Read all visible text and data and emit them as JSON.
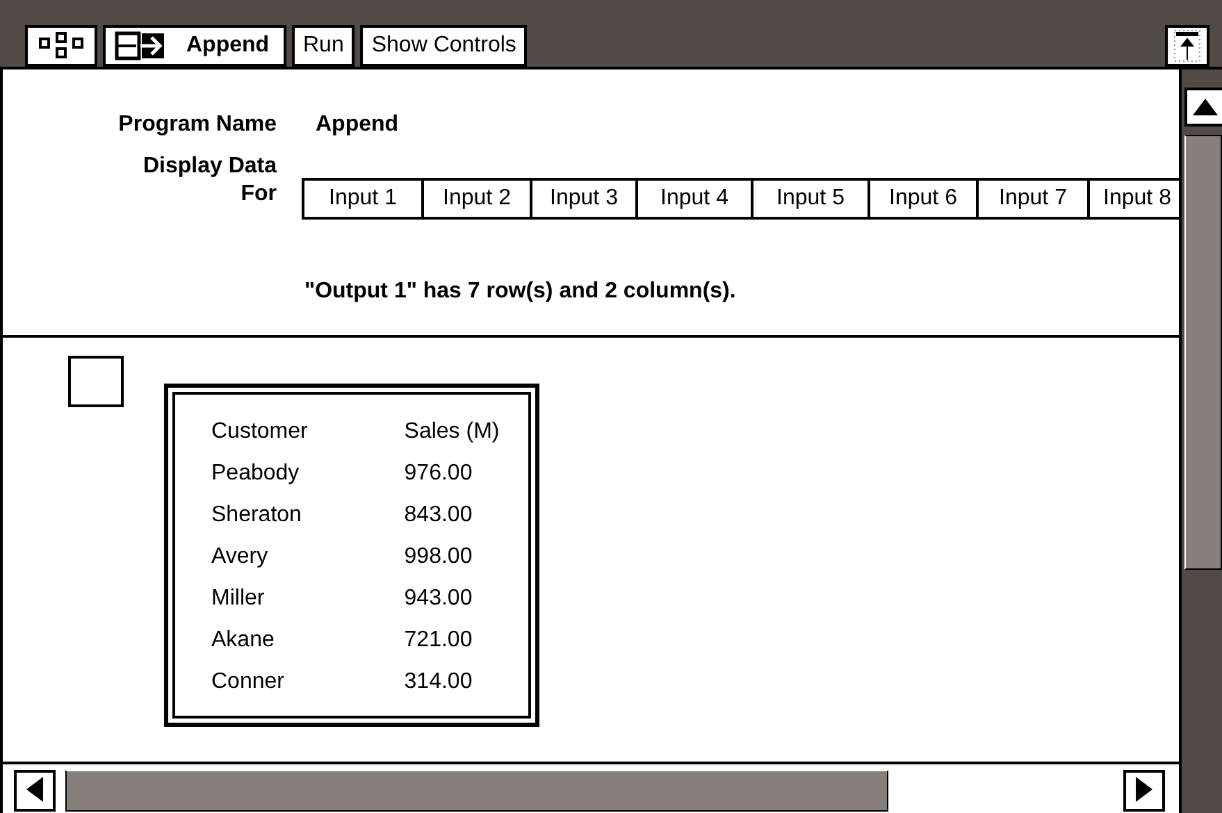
{
  "toolbar": {
    "program_button": "Append",
    "buttons": [
      "Run",
      "Show Controls"
    ]
  },
  "program": {
    "name_label": "Program Name",
    "name": "Append",
    "display_label": "Display Data For"
  },
  "inputs": [
    {
      "label": "Input 1"
    },
    {
      "label": "Input 2"
    },
    {
      "label": "Input 3"
    },
    {
      "label": "Input 4"
    },
    {
      "label": "Input 5"
    },
    {
      "label": "Input 6"
    },
    {
      "label": "Input 7"
    },
    {
      "label": "Input 8"
    }
  ],
  "message": "\"Output 1\" has 7 row(s) and 2 column(s).",
  "select_box": {
    "checked": false
  },
  "table": {
    "columns": [
      "Customer",
      "Sales (M)"
    ],
    "rows": [
      [
        "Peabody",
        "976.00"
      ],
      [
        "Sheraton",
        "843.00"
      ],
      [
        "Avery",
        "998.00"
      ],
      [
        "Miller",
        "943.00"
      ],
      [
        "Akane",
        "721.00"
      ],
      [
        "Conner",
        "314.00"
      ]
    ]
  }
}
